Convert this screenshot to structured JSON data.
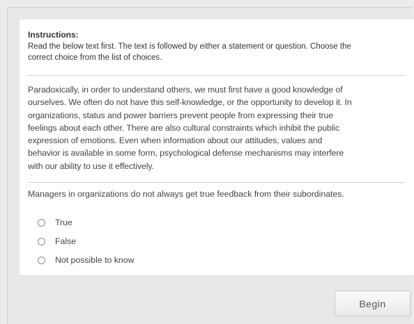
{
  "instructions": {
    "title": "Instructions:",
    "line1": "Read the below text first. The text is followed by either a statement or question. Choose the",
    "line2": "correct choice from the list of choices."
  },
  "passage": {
    "lines": [
      "Paradoxically, in order to understand others, we must first have a good knowledge of",
      "ourselves. We often do not have this self-knowledge, or the opportunity to develop it. In",
      "organizations, status and power barriers prevent people from expressing their true",
      "feelings about each other. There are also cultural constraints which inhibit the public",
      "expression of emotions. Even when information about our attitudes, values and",
      "behavior is available in some form, psychological defense mechanisms may interfere",
      "with our ability to use it effectively."
    ]
  },
  "statement": "Managers in organizations do not always get true feedback from their subordinates.",
  "options": [
    {
      "label": "True",
      "selected": false
    },
    {
      "label": "False",
      "selected": false
    },
    {
      "label": "Not possible to know",
      "selected": false
    }
  ],
  "footer": {
    "begin_label": "Begin"
  }
}
